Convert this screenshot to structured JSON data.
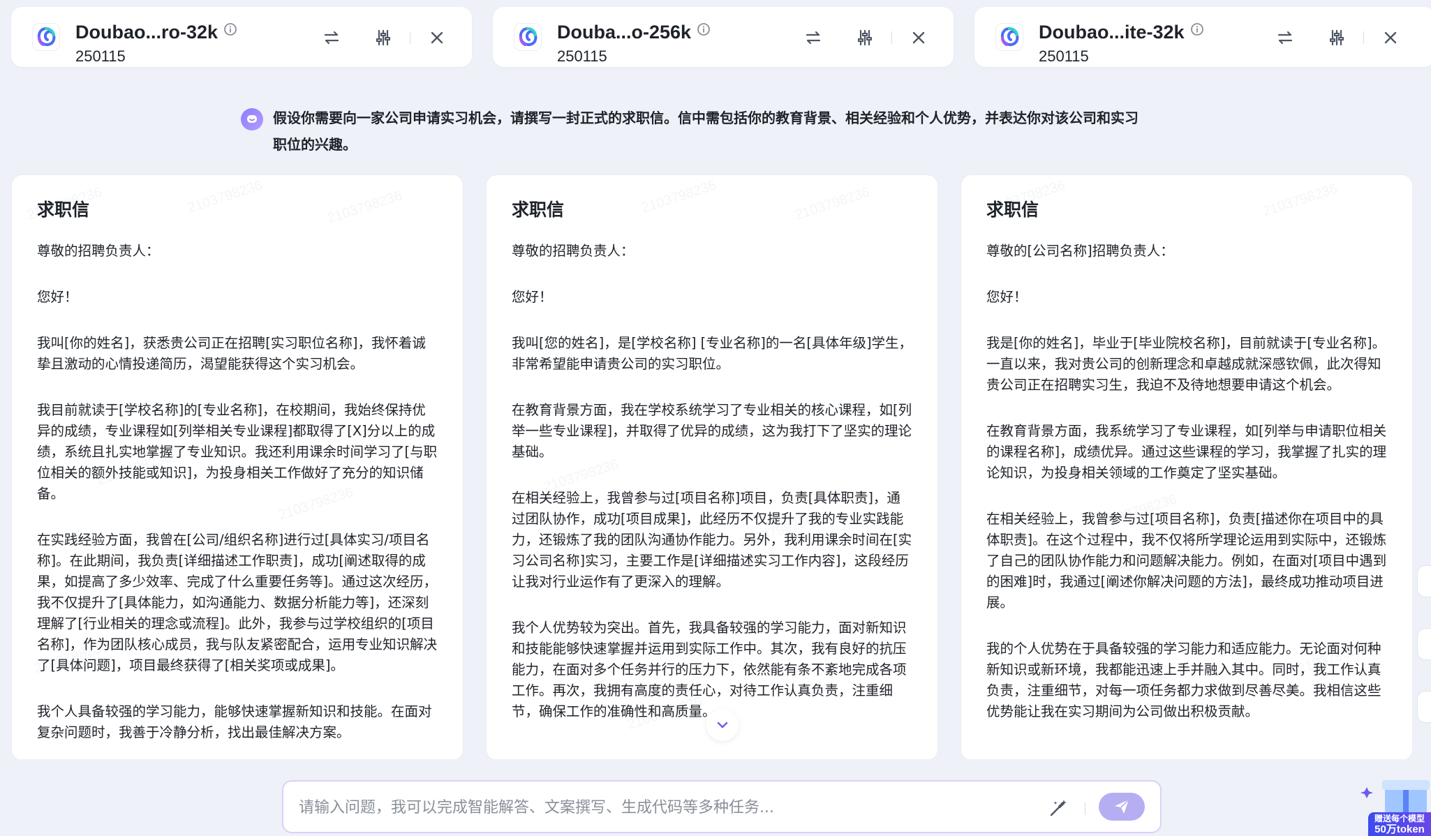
{
  "models": [
    {
      "name": "Doubao...ro-32k",
      "version": "250115"
    },
    {
      "name": "Douba...o-256k",
      "version": "250115"
    },
    {
      "name": "Doubao...ite-32k",
      "version": "250115"
    }
  ],
  "prompt": {
    "text": "假设你需要向一家公司申请实习机会，请撰写一封正式的求职信。信中需包括你的教育背景、相关经验和个人优势，并表达你对该公司和实习职位的兴趣。"
  },
  "watermark": "2103798236",
  "responses": [
    {
      "title": "求职信",
      "paragraphs": [
        "尊敬的招聘负责人：",
        "您好！",
        "我叫[你的姓名]，获悉贵公司正在招聘[实习职位名称]，我怀着诚挚且激动的心情投递简历，渴望能获得这个实习机会。",
        "我目前就读于[学校名称]的[专业名称]，在校期间，我始终保持优异的成绩，专业课程如[列举相关专业课程]都取得了[X]分以上的成绩，系统且扎实地掌握了专业知识。我还利用课余时间学习了[与职位相关的额外技能或知识]，为投身相关工作做好了充分的知识储备。",
        "在实践经验方面，我曾在[公司/组织名称]进行过[具体实习/项目名称]。在此期间，我负责[详细描述工作职责]，成功[阐述取得的成果，如提高了多少效率、完成了什么重要任务等]。通过这次经历，我不仅提升了[具体能力，如沟通能力、数据分析能力等]，还深刻理解了[行业相关的理念或流程]。此外，我参与过学校组织的[项目名称]，作为团队核心成员，我与队友紧密配合，运用专业知识解决了[具体问题]，项目最终获得了[相关奖项或成果]。",
        "我个人具备较强的学习能力，能够快速掌握新知识和技能。在面对复杂问题时，我善于冷静分析，找出最佳解决方案。"
      ]
    },
    {
      "title": "求职信",
      "paragraphs": [
        "尊敬的招聘负责人：",
        "您好！",
        "我叫[您的姓名]，是[学校名称] [专业名称]的一名[具体年级]学生，非常希望能申请贵公司的实习职位。",
        "在教育背景方面，我在学校系统学习了专业相关的核心课程，如[列举一些专业课程]，并取得了优异的成绩，这为我打下了坚实的理论基础。",
        "在相关经验上，我曾参与过[项目名称]项目，负责[具体职责]，通过团队协作，成功[项目成果]，此经历不仅提升了我的专业实践能力，还锻炼了我的团队沟通协作能力。另外，我利用课余时间在[实习公司名称]实习，主要工作是[详细描述实习工作内容]，这段经历让我对行业运作有了更深入的理解。",
        "我个人优势较为突出。首先，我具备较强的学习能力，面对新知识和技能能够快速掌握并运用到实际工作中。其次，我有良好的抗压能力，在面对多个任务并行的压力下，依然能有条不紊地完成各项工作。再次，我拥有高度的责任心，对待工作认真负责，注重细节，确保工作的准确性和高质量。"
      ]
    },
    {
      "title": "求职信",
      "paragraphs": [
        "尊敬的[公司名称]招聘负责人：",
        "您好！",
        "我是[你的姓名]，毕业于[毕业院校名称]，目前就读于[专业名称]。一直以来，我对贵公司的创新理念和卓越成就深感钦佩，此次得知贵公司正在招聘实习生，我迫不及待地想要申请这个机会。",
        "在教育背景方面，我系统学习了专业课程，如[列举与申请职位相关的课程名称]，成绩优异。通过这些课程的学习，我掌握了扎实的理论知识，为投身相关领域的工作奠定了坚实基础。",
        "在相关经验上，我曾参与过[项目名称]，负责[描述你在项目中的具体职责]。在这个过程中，我不仅将所学理论运用到实际中，还锻炼了自己的团队协作能力和问题解决能力。例如，在面对[项目中遇到的困难]时，我通过[阐述你解决问题的方法]，最终成功推动项目进展。",
        "我的个人优势在于具备较强的学习能力和适应能力。无论面对何种新知识或新环境，我都能迅速上手并融入其中。同时，我工作认真负责，注重细节，对每一项任务都力求做到尽善尽美。我相信这些优势能让我在实习期间为公司做出积极贡献。"
      ]
    }
  ],
  "input": {
    "placeholder": "请输入问题，我可以完成智能解答、文案撰写、生成代码等多种任务..."
  },
  "promo": {
    "line1": "赠送每个模型",
    "line2": "50万token"
  },
  "colors": {
    "background": "#eef1f8",
    "accent": "#8f7dfb",
    "send_button": "#b6aef3"
  }
}
